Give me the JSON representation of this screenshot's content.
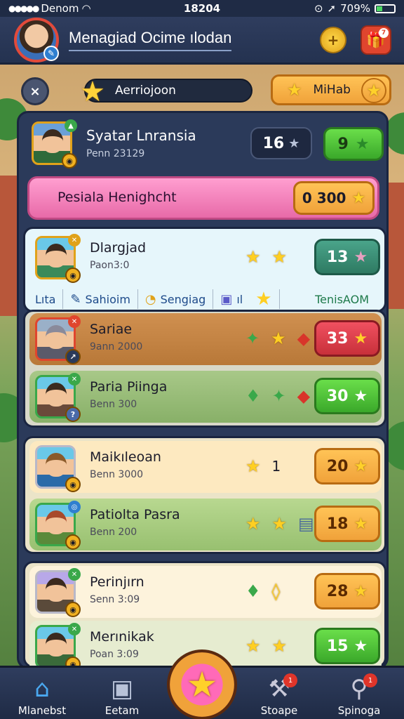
{
  "status": {
    "carrier": "Denom",
    "time": "18204",
    "battery": "709%"
  },
  "header": {
    "title": "Menagiad Ocime ılodan",
    "coin_btn": "+",
    "gift_badge": "7"
  },
  "controls": {
    "close_icon": "×",
    "search_label": "Aerriojoon",
    "mihab_label": "MiHab"
  },
  "player": {
    "name": "Syatar Lnransia",
    "sub": "Penn 23129",
    "count": "16",
    "score": "9"
  },
  "banner": {
    "label": "Pesiala Henighcht",
    "reward": "0 300"
  },
  "tabs": [
    {
      "label": "Lıta",
      "icon": ""
    },
    {
      "label": "Sahioim",
      "icon": "feather-icon"
    },
    {
      "label": "Sengiag",
      "icon": "clock-icon"
    },
    {
      "label": "ıl",
      "icon": "bag-icon"
    },
    {
      "label": "TenisAOM",
      "icon": "star-icon"
    }
  ],
  "groups": [
    {
      "rows": [
        {
          "name": "Dlargjad",
          "sub": "Paon3:0",
          "score": "13",
          "color": "teal",
          "icons": [
            "star",
            "star"
          ]
        }
      ]
    },
    {
      "rows": [
        {
          "name": "Sariae",
          "sub": "9ann 2000",
          "score": "33",
          "color": "red",
          "icons": [
            "green",
            "star",
            "red"
          ]
        },
        {
          "name": "Paria Piinga",
          "sub": "Benn 300",
          "score": "30",
          "color": "green",
          "icons": [
            "green",
            "green",
            "red"
          ]
        }
      ]
    },
    {
      "rows": [
        {
          "name": "Maikıleoan",
          "sub": "Benn 3000",
          "score": "20",
          "color": "orange",
          "icons": [
            "star",
            "num"
          ]
        },
        {
          "name": "Patiolta Pasra",
          "sub": "Benn 200",
          "score": "18",
          "color": "orange",
          "icons": [
            "star",
            "star",
            "blue"
          ]
        }
      ]
    },
    {
      "rows": [
        {
          "name": "Perinjırn",
          "sub": "Senn 3:09",
          "score": "28",
          "color": "orange",
          "icons": [
            "green",
            "star"
          ]
        },
        {
          "name": "Merınikak",
          "sub": "Poan 3:09",
          "score": "15",
          "color": "green",
          "icons": [
            "star",
            "star"
          ]
        }
      ]
    }
  ],
  "row_extra_num": "1",
  "nav": [
    {
      "label": "Mlanebst",
      "icon": "home-icon"
    },
    {
      "label": "Eetam",
      "icon": "card-icon"
    },
    {
      "label": "Stoape",
      "icon": "hammer-icon",
      "badge": "1"
    },
    {
      "label": "Spinoga",
      "icon": "search-icon",
      "badge": "1"
    }
  ],
  "colors": {
    "accent": "#f0a23a",
    "header_bg": "#2f3d5e",
    "pink": "#e86aa8",
    "green": "#3aa82a"
  }
}
